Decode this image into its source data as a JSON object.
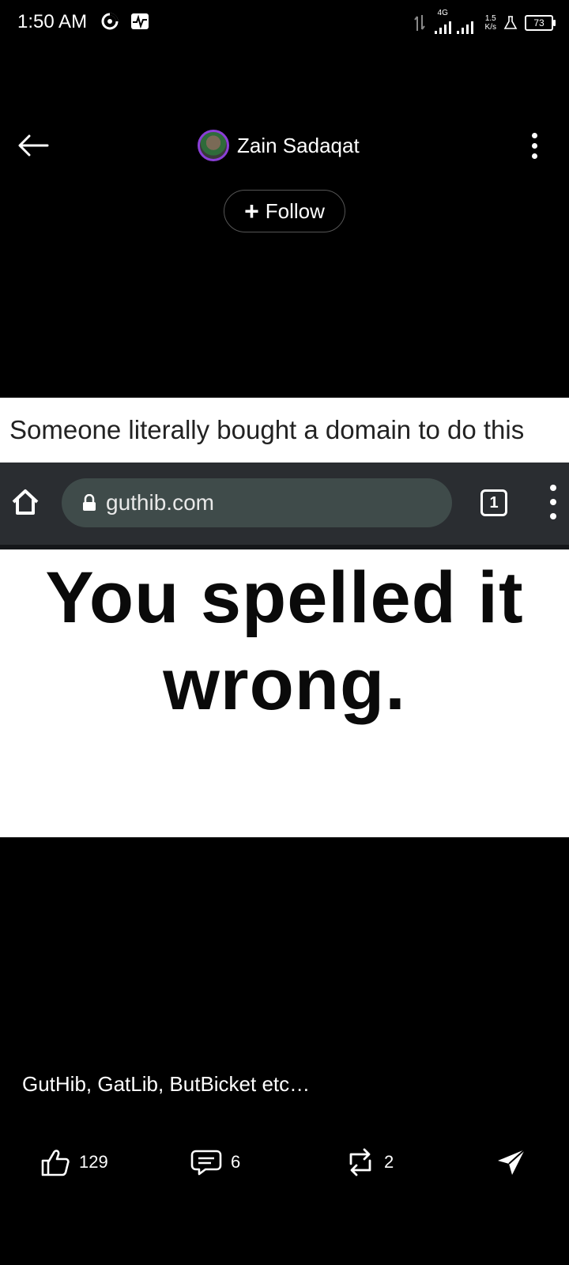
{
  "status_bar": {
    "time": "1:50 AM",
    "network": "4G",
    "speed_value": "1.5",
    "speed_unit": "K/s",
    "battery": "73"
  },
  "header": {
    "author_name": "Zain Sadaqat",
    "follow_label": "Follow"
  },
  "post_image": {
    "caption": "Someone literally bought a domain to do this",
    "url": "guthib.com",
    "tab_count": "1",
    "headline": "You spelled it wrong."
  },
  "post": {
    "text": "GutHib, GatLib, ButBicket etc…"
  },
  "actions": {
    "likes": "129",
    "comments": "6",
    "reposts": "2"
  }
}
